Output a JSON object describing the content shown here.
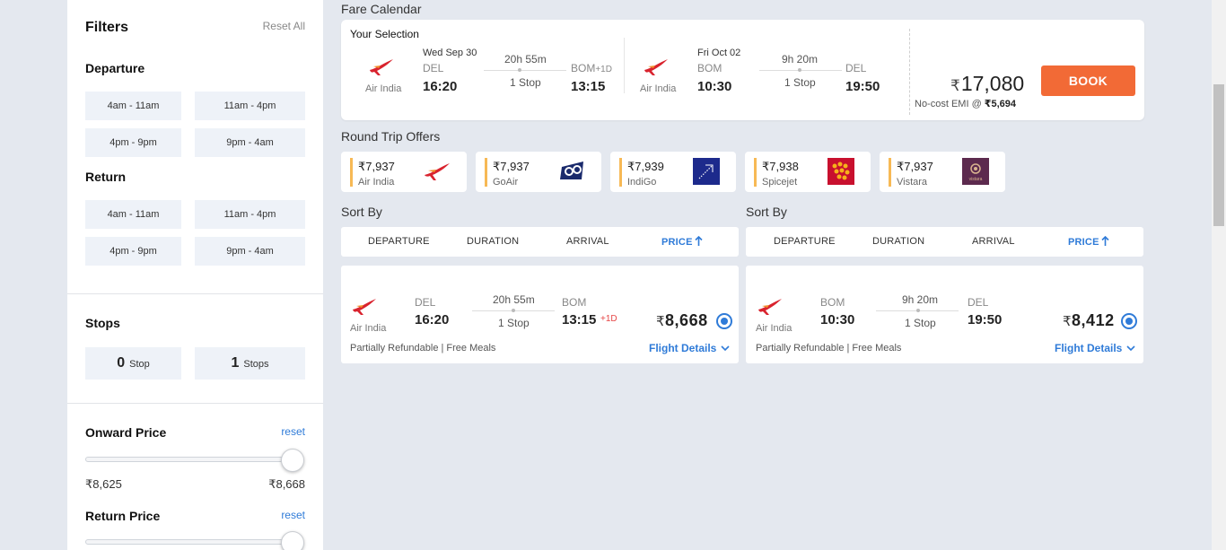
{
  "filters": {
    "title": "Filters",
    "reset_all": "Reset All",
    "departure": {
      "title": "Departure",
      "slots": [
        "4am - 11am",
        "11am - 4pm",
        "4pm - 9pm",
        "9pm - 4am"
      ]
    },
    "return": {
      "title": "Return",
      "slots": [
        "4am - 11am",
        "11am - 4pm",
        "4pm - 9pm",
        "9pm - 4am"
      ]
    },
    "stops": {
      "title": "Stops",
      "options": [
        {
          "num": "0",
          "label": "Stop"
        },
        {
          "num": "1",
          "label": "Stops"
        }
      ]
    },
    "onward_price": {
      "title": "Onward Price",
      "reset": "reset",
      "min": "₹8,625",
      "max": "₹8,668"
    },
    "return_price": {
      "title": "Return Price",
      "reset": "reset"
    }
  },
  "fare_calendar": {
    "title": "Fare Calendar",
    "your_selection": "Your Selection",
    "onward": {
      "airline": "Air India",
      "date": "Wed Sep 30",
      "from_code": "DEL",
      "from_time": "16:20",
      "duration": "20h 55m",
      "stops": "1 Stop",
      "to_code": "BOM",
      "to_suffix": "+1D",
      "to_time": "13:15"
    },
    "return": {
      "airline": "Air India",
      "date": "Fri Oct 02",
      "from_code": "BOM",
      "from_time": "10:30",
      "duration": "9h 20m",
      "stops": "1 Stop",
      "to_code": "DEL",
      "to_time": "19:50"
    },
    "total_currency": "₹",
    "total_price": "17,080",
    "emi_label": "No-cost EMI @",
    "emi_value": "₹5,694",
    "book_label": "BOOK"
  },
  "round_trip_offers": {
    "title": "Round Trip Offers",
    "offers": [
      {
        "price": "₹7,937",
        "airline": "Air India",
        "logo": "air-india-logo"
      },
      {
        "price": "₹7,937",
        "airline": "GoAir",
        "logo": "goair-logo"
      },
      {
        "price": "₹7,939",
        "airline": "IndiGo",
        "logo": "indigo-logo"
      },
      {
        "price": "₹7,938",
        "airline": "Spicejet",
        "logo": "spicejet-logo"
      },
      {
        "price": "₹7,937",
        "airline": "Vistara",
        "logo": "vistara-logo",
        "logo_text": "vistara"
      }
    ]
  },
  "sort": {
    "title": "Sort By",
    "options": [
      "DEPARTURE",
      "DURATION",
      "ARRIVAL",
      "PRICE"
    ],
    "active": "PRICE"
  },
  "results": [
    {
      "airline": "Air India",
      "from_code": "DEL",
      "from_time": "16:20",
      "duration": "20h 55m",
      "stops": "1 Stop",
      "to_code": "BOM",
      "to_time": "13:15",
      "to_suffix": "+1D",
      "currency": "₹",
      "price": "8,668",
      "info": "Partially Refundable | Free Meals",
      "details": "Flight Details"
    },
    {
      "airline": "Air India",
      "from_code": "BOM",
      "from_time": "10:30",
      "duration": "9h 20m",
      "stops": "1 Stop",
      "to_code": "DEL",
      "to_time": "19:50",
      "currency": "₹",
      "price": "8,412",
      "info": "Partially Refundable | Free Meals",
      "details": "Flight Details"
    }
  ],
  "colors": {
    "accent": "#2f7bd8",
    "book": "#f26a36",
    "offer_bar": "#f7b955",
    "background": "#e4e8ef"
  }
}
